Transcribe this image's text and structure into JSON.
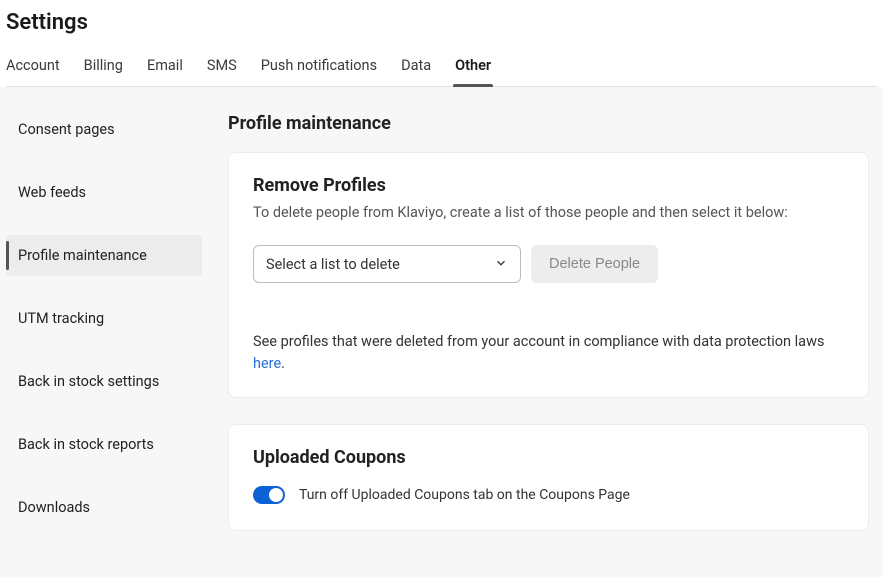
{
  "page": {
    "title": "Settings"
  },
  "tabs": [
    {
      "label": "Account",
      "active": false
    },
    {
      "label": "Billing",
      "active": false
    },
    {
      "label": "Email",
      "active": false
    },
    {
      "label": "SMS",
      "active": false
    },
    {
      "label": "Push notifications",
      "active": false
    },
    {
      "label": "Data",
      "active": false
    },
    {
      "label": "Other",
      "active": true
    }
  ],
  "sidebar": {
    "items": [
      {
        "label": "Consent pages",
        "active": false
      },
      {
        "label": "Web feeds",
        "active": false
      },
      {
        "label": "Profile maintenance",
        "active": true
      },
      {
        "label": "UTM tracking",
        "active": false
      },
      {
        "label": "Back in stock settings",
        "active": false
      },
      {
        "label": "Back in stock reports",
        "active": false
      },
      {
        "label": "Downloads",
        "active": false
      }
    ]
  },
  "main": {
    "heading": "Profile maintenance",
    "remove_profiles": {
      "title": "Remove Profiles",
      "desc": "To delete people from Klaviyo, create a list of those people and then select it below:",
      "select_placeholder": "Select a list to delete",
      "delete_button": "Delete People",
      "compliance_prefix": "See profiles that were deleted from your account in compliance with data protection laws ",
      "compliance_link": "here",
      "compliance_suffix": "."
    },
    "uploaded_coupons": {
      "title": "Uploaded Coupons",
      "toggle_label": "Turn off Uploaded Coupons tab on the Coupons Page",
      "toggle_state": true
    }
  }
}
